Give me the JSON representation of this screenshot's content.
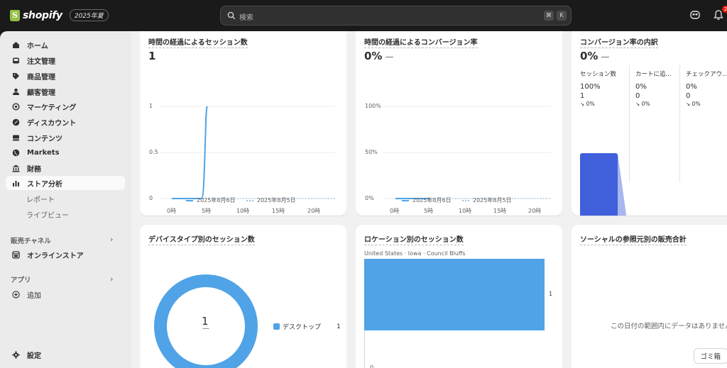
{
  "topbar": {
    "brand": "shopify",
    "edition": "2025年夏",
    "search_placeholder": "検索",
    "shortcut_keys": [
      "⌘",
      "K"
    ],
    "notification_count": "2"
  },
  "sidebar": {
    "items": [
      {
        "label": "ホーム",
        "icon": "home-icon"
      },
      {
        "label": "注文管理",
        "icon": "inbox-icon"
      },
      {
        "label": "商品管理",
        "icon": "tag-icon"
      },
      {
        "label": "顧客管理",
        "icon": "person-icon"
      },
      {
        "label": "マーケティング",
        "icon": "target-icon"
      },
      {
        "label": "ディスカウント",
        "icon": "discount-icon"
      },
      {
        "label": "コンテンツ",
        "icon": "content-icon"
      },
      {
        "label": "Markets",
        "icon": "globe-icon"
      },
      {
        "label": "財務",
        "icon": "bank-icon"
      },
      {
        "label": "ストア分析",
        "icon": "analytics-icon",
        "active": true
      }
    ],
    "subitems": [
      "レポート",
      "ライブビュー"
    ],
    "sales_channels_label": "販売チャネル",
    "online_store_label": "オンラインストア",
    "apps_label": "アプリ",
    "add_label": "追加",
    "settings_label": "設定"
  },
  "cards": {
    "sessions_over_time": {
      "title": "時間の経過によるセッション数",
      "value": "1",
      "y_ticks": [
        "1",
        "0.5",
        "0"
      ],
      "x_ticks": [
        "0時",
        "5時",
        "10時",
        "15時",
        "20時"
      ],
      "legend": [
        "2025年8月6日",
        "2025年8月5日"
      ]
    },
    "conversion_over_time": {
      "title": "時間の経過によるコンバージョン率",
      "value": "0%",
      "value_suffix": "—",
      "y_ticks": [
        "100%",
        "50%",
        "0%"
      ],
      "x_ticks": [
        "0時",
        "5時",
        "10時",
        "15時",
        "20時"
      ],
      "legend": [
        "2025年8月6日",
        "2025年8月5日"
      ]
    },
    "conversion_breakdown": {
      "title": "コンバージョン率の内訳",
      "value": "0%",
      "value_suffix": "—",
      "steps": [
        {
          "label": "セッション数",
          "pct": "100%",
          "count": "1",
          "change": "↘ 0%"
        },
        {
          "label": "カートに追…",
          "pct": "0%",
          "count": "0",
          "change": "↘ 0%"
        },
        {
          "label": "チェックアウ…",
          "pct": "0%",
          "count": "0",
          "change": "↘ 0%"
        }
      ]
    },
    "sessions_by_device": {
      "title": "デバイスタイプ別のセッション数",
      "center_value": "1",
      "center_sub": "—",
      "legend_label": "デスクトップ",
      "legend_value": "1"
    },
    "sessions_by_location": {
      "title": "ロケーション別のセッション数",
      "bar_label": "United States · Iowa · Council Bluffs",
      "bar_value": "1",
      "axis_zero": "0"
    },
    "social_referrer_sales": {
      "title": "ソーシャルの参照元別の販売合計",
      "empty_text": "この日付の範囲内にデータはありません"
    }
  },
  "trash_label": "ゴミ箱",
  "chart_data": [
    {
      "type": "line",
      "title": "時間の経過によるセッション数",
      "x": [
        "0時",
        "1時",
        "2時",
        "3時",
        "4時",
        "5時",
        "6時",
        "7時",
        "8時",
        "9時",
        "10時",
        "11時",
        "12時",
        "13時",
        "14時",
        "15時",
        "16時",
        "17時",
        "18時",
        "19時",
        "20時",
        "21時",
        "22時",
        "23時"
      ],
      "series": [
        {
          "name": "2025年8月6日",
          "values": [
            0,
            0,
            0,
            0,
            0,
            1
          ]
        },
        {
          "name": "2025年8月5日",
          "values": [
            0,
            0,
            0,
            0,
            0,
            0,
            0,
            0,
            0,
            0,
            0,
            0,
            0,
            0,
            0,
            0,
            0,
            0,
            0,
            0,
            0,
            0,
            0,
            0
          ]
        }
      ],
      "ylim": [
        0,
        1
      ]
    },
    {
      "type": "line",
      "title": "時間の経過によるコンバージョン率",
      "x": [
        "0時",
        "1時",
        "2時",
        "3時",
        "4時",
        "5時",
        "6時",
        "7時",
        "8時",
        "9時",
        "10時",
        "11時",
        "12時",
        "13時",
        "14時",
        "15時",
        "16時",
        "17時",
        "18時",
        "19時",
        "20時",
        "21時",
        "22時",
        "23時"
      ],
      "series": [
        {
          "name": "2025年8月6日",
          "values": [
            0,
            0,
            0,
            0,
            0,
            0
          ]
        },
        {
          "name": "2025年8月5日",
          "values": [
            0,
            0,
            0,
            0,
            0,
            0,
            0,
            0,
            0,
            0,
            0,
            0,
            0,
            0,
            0,
            0,
            0,
            0,
            0,
            0,
            0,
            0,
            0,
            0
          ]
        }
      ],
      "ylim": [
        0,
        100
      ]
    },
    {
      "type": "bar",
      "title": "ロケーション別のセッション数",
      "categories": [
        "United States · Iowa · Council Bluffs"
      ],
      "values": [
        1
      ]
    },
    {
      "type": "pie",
      "title": "デバイスタイプ別のセッション数",
      "categories": [
        "デスクトップ"
      ],
      "values": [
        1
      ]
    }
  ],
  "colors": {
    "accent_blue": "#4fa3e6",
    "funnel_blue": "#3f5fdb",
    "sidebar_bg": "#ebebeb",
    "topbar_bg": "#1a1a1a"
  }
}
